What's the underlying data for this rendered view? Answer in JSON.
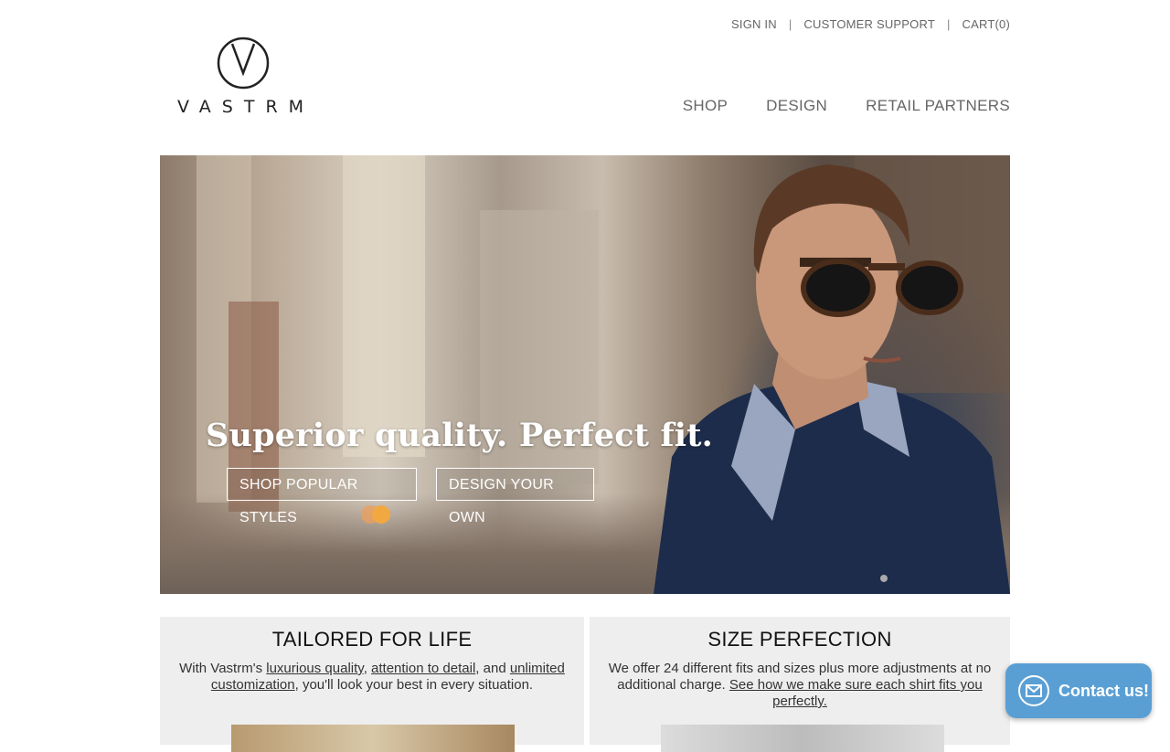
{
  "util_nav": {
    "sign_in": "SIGN IN",
    "customer_support": "CUSTOMER SUPPORT",
    "cart": "CART(0)",
    "separator": "|"
  },
  "brand": {
    "name": "VASTRM"
  },
  "main_nav": {
    "shop": "SHOP",
    "design": "DESIGN",
    "retail_partners": "RETAIL PARTNERS"
  },
  "hero": {
    "headline": "Superior quality. Perfect fit.",
    "btn_shop": "SHOP POPULAR STYLES",
    "btn_design": "DESIGN YOUR OWN"
  },
  "cards": {
    "left": {
      "title": "TAILORED FOR LIFE",
      "t1": "With Vastrm's ",
      "l1": "luxurious quality",
      "t2": ", ",
      "l2": "attention to detail",
      "t3": ", and ",
      "l3": "unlimited customization",
      "t4": ", you'll look your best in every situation."
    },
    "right": {
      "title": "SIZE PERFECTION",
      "t1": "We offer 24 different fits and sizes plus more adjustments at no additional charge. ",
      "l1": "See how we make sure each shirt fits you perfectly."
    }
  },
  "contact_widget": {
    "label": "Contact us!",
    "icon": "envelope-icon"
  },
  "colors": {
    "widget": "#5a9fd4",
    "card_bg": "#eeeeee",
    "nav_text": "#666666"
  }
}
